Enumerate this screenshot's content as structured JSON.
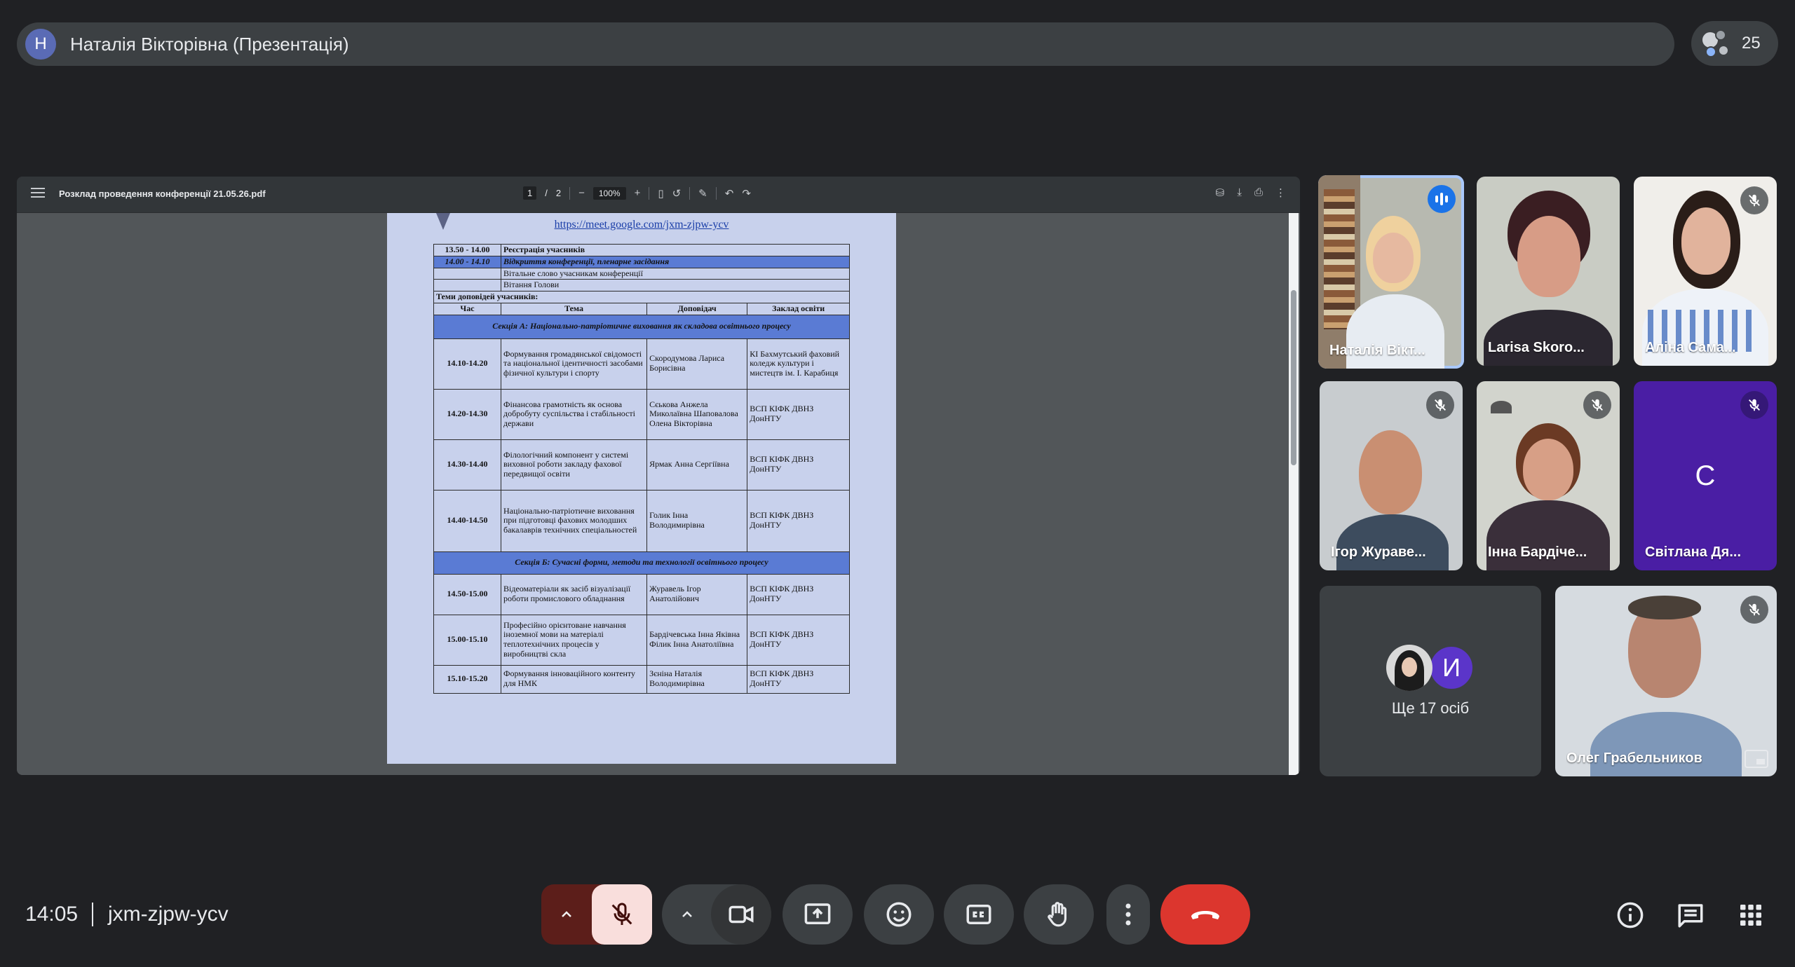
{
  "presenter": {
    "avatar_initial": "Н",
    "title": "Наталія Вікторівна (Презентація)"
  },
  "people": {
    "count": "25"
  },
  "pdf": {
    "filename": "Розклад проведення конференції 21.05.26.pdf",
    "page_current": "1",
    "page_sep": "/",
    "page_total": "2",
    "zoom": "100%",
    "link": "https://meet.google.com/jxm-zjpw-ycv",
    "schedule": {
      "rows": [
        {
          "time": "13.50 - 14.00",
          "text": "Реєстрація учасників"
        },
        {
          "time": "14.00 - 14.10",
          "text": "Відкриття конференції, пленарне засідання"
        }
      ],
      "subrows": [
        "Вітальне слово учасникам конференції",
        "Вітання Голови"
      ],
      "topics_label": "Теми доповідей учасників:",
      "headers": [
        "Час",
        "Тема",
        "Доповідач",
        "Заклад освіти"
      ],
      "section_a": "Секція А: Національно-патріотичне виховання як складова освітнього процесу",
      "section_a_rows": [
        {
          "time": "14.10-14.20",
          "topic": "Формування громадянської свідомості та національної ідентичності засобами фізичної культури і спорту",
          "speaker": "Скородумова Лариса Борисівна",
          "school": "КІ Бахмутський фаховий коледж культури і мистецтв ім. І. Карабиця"
        },
        {
          "time": "14.20-14.30",
          "topic": "Фінансова грамотність як основа добробуту суспільства і стабільності держави",
          "speaker": "Сєькова Анжела Миколаївна Шаповалова Олена Вікторівна",
          "school": "ВСП КІФК ДВНЗ ДонНТУ"
        },
        {
          "time": "14.30-14.40",
          "topic": "Філологічний компонент у системі виховної роботи закладу фахової передвищої освіти",
          "speaker": "Ярмак Анна Сергіївна",
          "school": "ВСП КІФК ДВНЗ ДонНТУ"
        },
        {
          "time": "14.40-14.50",
          "topic": "Національно-патріотичне виховання при підготовці фахових молодших бакалаврів технічних спеціальностей",
          "speaker": "Голик Інна Володимирівна",
          "school": "ВСП КІФК ДВНЗ ДонНТУ"
        }
      ],
      "section_b": "Секція Б: Сучасні форми, методи та технології освітнього процесу",
      "section_b_rows": [
        {
          "time": "14.50-15.00",
          "topic": "Відеоматеріали як засіб візуалізації роботи промислового обладнання",
          "speaker": "Журавель Ігор Анатолійович",
          "school": "ВСП КІФК ДВНЗ ДонНТУ"
        },
        {
          "time": "15.00-15.10",
          "topic": "Професійно орієнтоване навчання іноземної мови на матеріалі теплотехнічних процесів у виробництві скла",
          "speaker": "Бардічевська Інна Яківна Філик Інна Анатоліївна",
          "school": "ВСП КІФК ДВНЗ ДонНТУ"
        },
        {
          "time": "15.10-15.20",
          "topic": "Формування інноваційного контенту для НМК",
          "speaker": "Зєніна Наталія Володимирівна",
          "school": "ВСП КІФК ДВНЗ ДонНТУ"
        }
      ]
    }
  },
  "participants": [
    {
      "name": "Наталія Вікт...",
      "state": "speaking"
    },
    {
      "name": "Larisa Skoro...",
      "state": "muted"
    },
    {
      "name": "Аліна Сама...",
      "state": "muted"
    },
    {
      "name": "Ігор Жураве...",
      "state": "muted"
    },
    {
      "name": "Інна Бардіче...",
      "state": "muted"
    },
    {
      "name": "Світлана Дя...",
      "state": "muted",
      "initial": "С"
    },
    {
      "name": "Олег Грабельников",
      "state": "muted"
    }
  ],
  "more": {
    "initial": "И",
    "label": "Ще 17 осіб"
  },
  "meeting": {
    "time": "14:05",
    "code": "jxm-zjpw-ycv"
  },
  "colors": {
    "background": "#202124",
    "leave": "#dc362e",
    "mic_off": "#f9dedc",
    "slide_header": "#5a7bd4",
    "speaking": "#1a73e8"
  }
}
